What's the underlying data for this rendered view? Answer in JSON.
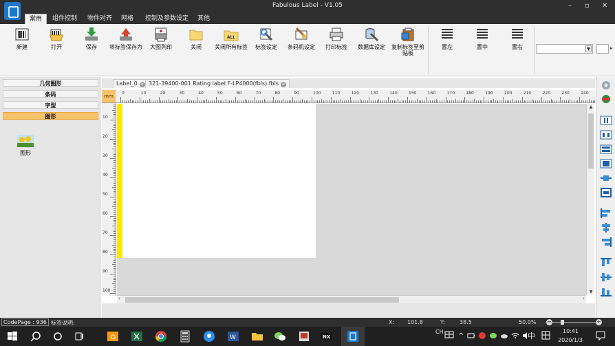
{
  "window": {
    "title": "Fabulous Label - V1.05",
    "minimize": "–",
    "restore": "▫",
    "close": "✕"
  },
  "menu": {
    "tabs": [
      "常用",
      "组件控制",
      "物件对齐",
      "网格",
      "控制及参数设定",
      "其他"
    ],
    "active_index": 0
  },
  "ribbon": {
    "tools": [
      {
        "label": "新建",
        "icon": "barcode-new-icon"
      },
      {
        "label": "打开",
        "icon": "folder-open-icon"
      },
      {
        "label": "保存",
        "icon": "save-icon"
      },
      {
        "label": "将标签保存为",
        "icon": "save-as-icon"
      },
      {
        "label": "大图列印",
        "icon": "large-print-icon"
      },
      {
        "label": "关闭",
        "icon": "folder-close-icon"
      },
      {
        "label": "关闭所有标签",
        "icon": "close-all-icon"
      },
      {
        "label": "标签设定",
        "icon": "label-settings-icon"
      },
      {
        "label": "条码机设定",
        "icon": "barcode-printer-settings-icon"
      },
      {
        "label": "打印标签",
        "icon": "print-label-icon"
      },
      {
        "label": "数据库设定",
        "icon": "database-settings-icon"
      },
      {
        "label": "复制标签至剪贴板",
        "icon": "copy-to-clipboard-icon"
      }
    ],
    "align_tools": [
      {
        "label": "置左",
        "icon": "align-left-icon"
      },
      {
        "label": "置中",
        "icon": "align-center-icon"
      },
      {
        "label": "置右",
        "icon": "align-right-icon"
      }
    ],
    "close_all_badge": "ALL"
  },
  "leftpanel": {
    "categories": [
      "几何图形",
      "条码",
      "字型",
      "图形"
    ],
    "active_index": 3,
    "items": [
      {
        "label": "图形",
        "icon": "picture-icon"
      }
    ]
  },
  "doctabs": [
    {
      "label": "Label_0",
      "close": "✕"
    },
    {
      "label": "321-39400-001 Rating label F-LP4000(fbls).fbls",
      "close": "✕"
    }
  ],
  "ruler": {
    "unit": "mm",
    "h_ticks": [
      "0",
      "10",
      "20",
      "30",
      "40",
      "50",
      "60",
      "70",
      "80",
      "90",
      "100",
      "110",
      "120",
      "130",
      "140",
      "150",
      "160",
      "170",
      "180",
      "190",
      "200",
      "210",
      "220",
      "230",
      "240"
    ],
    "v_ticks": [
      "10",
      "20",
      "30",
      "40",
      "50",
      "60",
      "70",
      "80",
      "90",
      "100"
    ]
  },
  "status": {
    "codepage": "CodePage : 936",
    "label_desc": "标签说明:",
    "x_label": "X:",
    "x_value": "101.8",
    "y_label": "Y:",
    "y_value": "38.5",
    "zoom": "50.0%",
    "zoom_fraction": 0.3
  },
  "taskbar": {
    "lang": "CH",
    "ime": "中",
    "time": "10:41",
    "date": "2020/1/3",
    "apps": [
      "outlook-icon",
      "excel-icon",
      "chrome-icon",
      "calculator-icon",
      "meeting-icon",
      "word-icon",
      "file-explorer-icon",
      "wechat-icon",
      "photo-viewer-icon",
      "nx-icon",
      "fabulous-label-icon"
    ]
  }
}
